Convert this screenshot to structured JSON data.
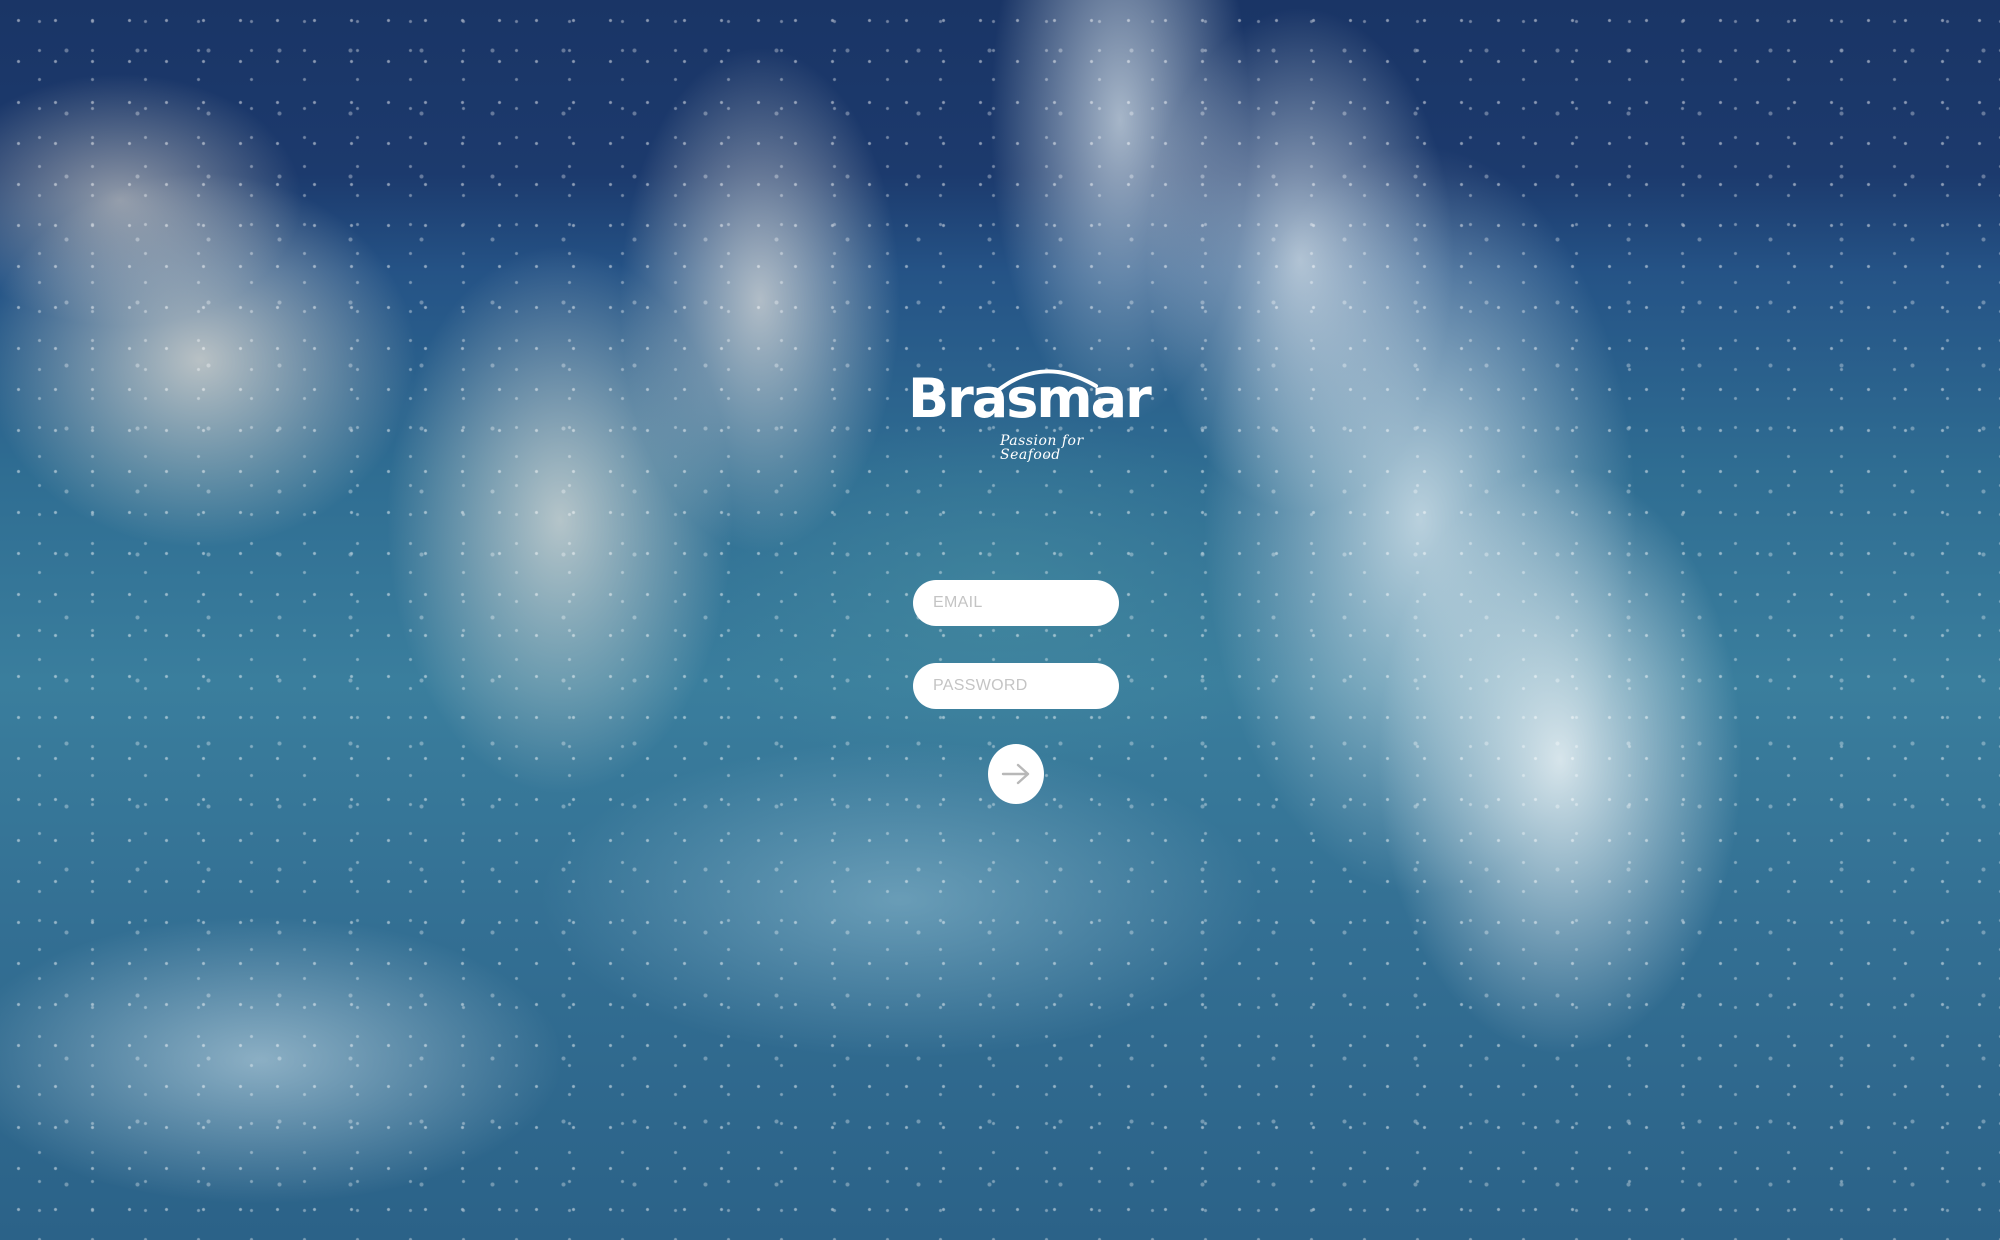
{
  "brand": {
    "name": "Brasmar",
    "tagline": "Passion for Seafood"
  },
  "login_form": {
    "email_placeholder": "EMAIL",
    "password_placeholder": "PASSWORD",
    "submit_icon": "arrow-right-icon"
  },
  "colors": {
    "field_background": "#ffffff",
    "placeholder_text": "#c4c4c4",
    "submit_arrow": "#b8b8b8"
  }
}
